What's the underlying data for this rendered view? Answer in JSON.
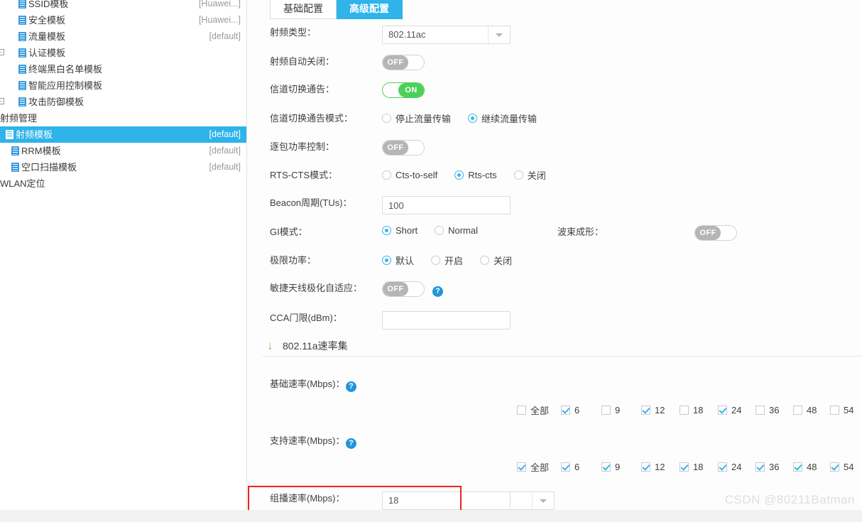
{
  "sidebar": {
    "items": [
      {
        "label": "SSID模板",
        "tag": "[Huawei...]",
        "indent": 26,
        "icon": "document-icon",
        "expander": "",
        "selected": false,
        "partial_top": false
      },
      {
        "label": "安全模板",
        "tag": "[Huawei...]",
        "indent": 26,
        "icon": "document-icon",
        "expander": "",
        "selected": false,
        "partial_top": false
      },
      {
        "label": "流量模板",
        "tag": "[default]",
        "indent": 26,
        "icon": "document-icon",
        "expander": "",
        "selected": false,
        "partial_top": false
      },
      {
        "label": "认证模板",
        "tag": "",
        "indent": 26,
        "icon": "document-icon",
        "expander": "⊟",
        "selected": false,
        "partial_top": false
      },
      {
        "label": "终端黑白名单模板",
        "tag": "",
        "indent": 26,
        "icon": "document-icon",
        "expander": "",
        "selected": false,
        "partial_top": false
      },
      {
        "label": "智能应用控制模板",
        "tag": "",
        "indent": 26,
        "icon": "document-icon",
        "expander": "",
        "selected": false,
        "partial_top": false
      },
      {
        "label": "攻击防御模板",
        "tag": "",
        "indent": 26,
        "icon": "document-icon",
        "expander": "⊟",
        "selected": false,
        "partial_top": false
      },
      {
        "label": "射频管理",
        "tag": "",
        "indent": 0,
        "icon": "",
        "expander": "",
        "selected": false,
        "partial_top": false
      },
      {
        "label": "射频模板",
        "tag": "[default]",
        "indent": 8,
        "icon": "document-icon",
        "expander": "",
        "selected": true,
        "partial_top": false
      },
      {
        "label": "RRM模板",
        "tag": "[default]",
        "indent": 16,
        "icon": "document-icon",
        "expander": "",
        "selected": false,
        "partial_top": false
      },
      {
        "label": "空口扫描模板",
        "tag": "[default]",
        "indent": 16,
        "icon": "document-icon",
        "expander": "",
        "selected": false,
        "partial_top": false
      },
      {
        "label": "WLAN定位",
        "tag": "",
        "indent": 0,
        "icon": "",
        "expander": "",
        "selected": false,
        "partial_top": false
      }
    ]
  },
  "tabs": [
    {
      "label": "基础配置",
      "active": false
    },
    {
      "label": "高级配置",
      "active": true
    }
  ],
  "form": {
    "radio_type": {
      "label": "射频类型：",
      "value": "802.11ac"
    },
    "radio_auto_off": {
      "label": "射频自动关闭：",
      "state": "OFF"
    },
    "channel_switch_ann": {
      "label": "信道切换通告：",
      "state": "ON"
    },
    "channel_switch_mode": {
      "label": "信道切换通告模式：",
      "options": [
        {
          "label": "停止流量传输",
          "checked": false
        },
        {
          "label": "继续流量传输",
          "checked": true
        }
      ]
    },
    "per_packet_power": {
      "label": "逐包功率控制：",
      "state": "OFF"
    },
    "rts_cts_mode": {
      "label": "RTS-CTS模式：",
      "options": [
        {
          "label": "Cts-to-self",
          "checked": false
        },
        {
          "label": "Rts-cts",
          "checked": true
        },
        {
          "label": "关闭",
          "checked": false
        }
      ]
    },
    "beacon_period": {
      "label": "Beacon周期(TUs)：",
      "value": "100"
    },
    "gi_mode": {
      "label": "GI模式：",
      "options": [
        {
          "label": "Short",
          "checked": true
        },
        {
          "label": "Normal",
          "checked": false
        }
      ]
    },
    "beamforming": {
      "label": "波束成形：",
      "state": "OFF"
    },
    "limit_power": {
      "label": "极限功率：",
      "options": [
        {
          "label": "默认",
          "checked": true
        },
        {
          "label": "开启",
          "checked": false
        },
        {
          "label": "关闭",
          "checked": false
        }
      ]
    },
    "smart_antenna": {
      "label": "敏捷天线极化自适应：",
      "state": "OFF",
      "help": "?"
    },
    "cca_threshold": {
      "label": "CCA门限(dBm)：",
      "value": ""
    }
  },
  "section": {
    "title": "802.11a速率集",
    "arrow_icon": "down-arrow-icon"
  },
  "rate_sets": {
    "basic": {
      "label": "基础速率(Mbps)：",
      "help": "?",
      "items": [
        {
          "label": "全部",
          "checked": false
        },
        {
          "label": "6",
          "checked": true
        },
        {
          "label": "9",
          "checked": false
        },
        {
          "label": "12",
          "checked": true
        },
        {
          "label": "18",
          "checked": false
        },
        {
          "label": "24",
          "checked": true
        },
        {
          "label": "36",
          "checked": false
        },
        {
          "label": "48",
          "checked": false
        },
        {
          "label": "54",
          "checked": false
        }
      ]
    },
    "support": {
      "label": "支持速率(Mbps)：",
      "help": "?",
      "items": [
        {
          "label": "全部",
          "checked": true
        },
        {
          "label": "6",
          "checked": true
        },
        {
          "label": "9",
          "checked": true
        },
        {
          "label": "12",
          "checked": true
        },
        {
          "label": "18",
          "checked": true
        },
        {
          "label": "24",
          "checked": true
        },
        {
          "label": "36",
          "checked": true
        },
        {
          "label": "48",
          "checked": true
        },
        {
          "label": "54",
          "checked": true
        }
      ]
    },
    "multicast": {
      "label": "组播速率(Mbps)：",
      "value": "18"
    }
  },
  "watermark": "CSDN @80211Batman",
  "colors": {
    "accent": "#2eb3ea",
    "toggle_on": "#4cd05a",
    "toggle_off": "#b5b5b5",
    "check": "#35b5ec",
    "highlight_box": "#ee2222",
    "help_icon": "#2196dd"
  }
}
